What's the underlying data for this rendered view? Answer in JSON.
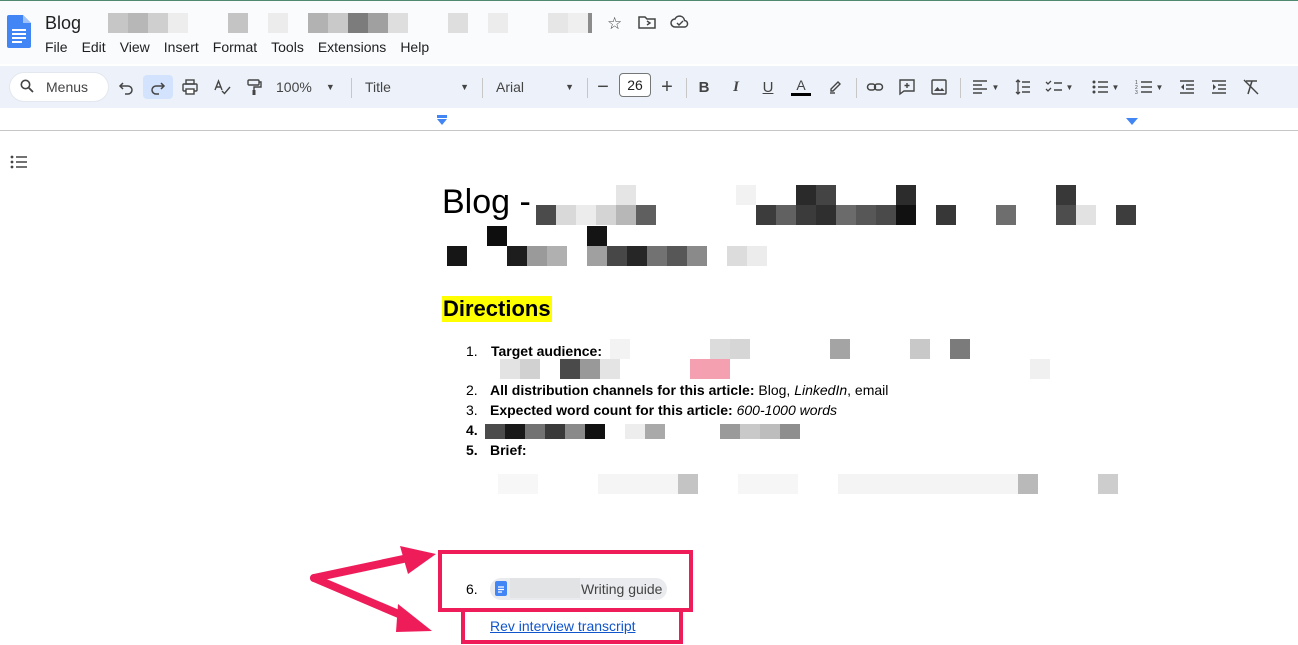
{
  "app": {
    "doc_title": "Blog"
  },
  "menu": [
    "File",
    "Edit",
    "View",
    "Insert",
    "Format",
    "Tools",
    "Extensions",
    "Help"
  ],
  "toolbar": {
    "search_label": "Menus",
    "zoom": "100%",
    "style": "Title",
    "font": "Arial",
    "font_size": "26"
  },
  "document": {
    "title": "Blog -",
    "directions_heading": "Directions",
    "items": [
      {
        "number": "1.",
        "label": "Target audience:"
      },
      {
        "number": "2.",
        "label": "All distribution channels for this article:",
        "value_plain1": " Blog, ",
        "value_italic": "LinkedIn",
        "value_plain2": ", email"
      },
      {
        "number": "3.",
        "label": "Expected word count for this article:",
        "value_italic": " 600-1000 words"
      },
      {
        "number": "4."
      },
      {
        "number": "5.",
        "label": "Brief:"
      },
      {
        "number": "6.",
        "chip_label": "Writing guide"
      }
    ],
    "link_text": "Rev interview transcript"
  },
  "annotation": {
    "highlight_color": "#ee1d5a"
  },
  "colors": {
    "toolbar_bg": "#edf2fa",
    "accent": "#1a73e8",
    "link": "#1155cc",
    "highlight": "#ffff00"
  }
}
